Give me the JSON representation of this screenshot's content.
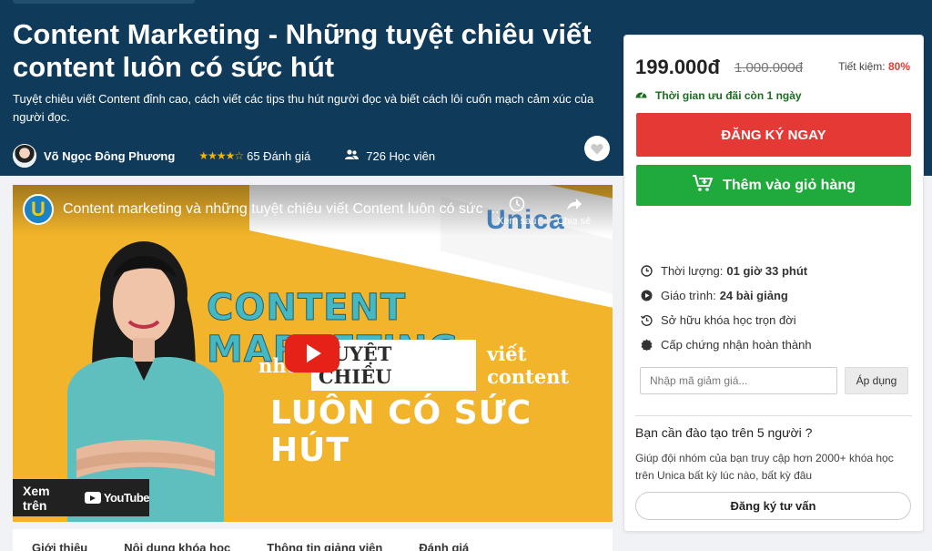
{
  "course": {
    "title": "Content Marketing - Những tuyệt chiêu viết content luôn có sức hút",
    "subtitle": "Tuyệt chiêu viết Content đỉnh cao, cách viết các tips thu hút người đọc và biết cách lôi cuốn mạch cảm xúc của người đọc.",
    "author": "Võ Ngọc Đông Phương",
    "stars": "★★★★☆",
    "rating_value": 4,
    "rating_count": "65 Đánh giá",
    "students": "726 Học viên"
  },
  "video": {
    "logo_letter": "U",
    "title": "Content marketing và những tuyệt chiêu viết Content luôn có sức ...",
    "watch_later": "Xem sau",
    "share": "Chia sẻ",
    "brand_word": "Unica",
    "headline_1": "CONTENT MARKETING",
    "headline_2_pre": "nhữ",
    "headline_2_box": "TUYỆT CHIÊU",
    "headline_2_post": "viết content",
    "headline_3": "LUÔN CÓ SỨC HÚT",
    "watch_on": "Xem trên",
    "youtube": "YouTube"
  },
  "tabs": [
    "Giới thiệu",
    "Nội dung khóa học",
    "Thông tin giảng viên",
    "Đánh giá"
  ],
  "pricing": {
    "price": "199.000đ",
    "old_price": "1.000.000đ",
    "save_label": "Tiết kiệm:",
    "save_percent": "80%",
    "timer": "Thời gian ưu đãi còn 1 ngày",
    "register_button": "ĐĂNG KÝ NGAY",
    "cart_button": "Thêm vào giỏ hàng"
  },
  "features": {
    "duration_label": "Thời lượng:",
    "duration_value": "01 giờ 33 phút",
    "lessons_label": "Giáo trình:",
    "lessons_value": "24 bài giảng",
    "lifetime": "Sở hữu khóa học trọn đời",
    "certificate": "Cấp chứng nhận hoàn thành"
  },
  "coupon": {
    "placeholder": "Nhập mã giảm giá...",
    "apply": "Áp dụng"
  },
  "team": {
    "title": "Bạn cần đào tạo trên 5 người ?",
    "text": "Giúp đội nhóm của bạn truy cập hơn 2000+ khóa học trên Unica bất kỳ lúc nào, bất kỳ đâu",
    "button": "Đăng ký tư vấn"
  },
  "colors": {
    "hero_bg": "#0f3a5a",
    "register": "#e53935",
    "cart": "#1faa3b",
    "video_bg": "#f2b42a"
  }
}
